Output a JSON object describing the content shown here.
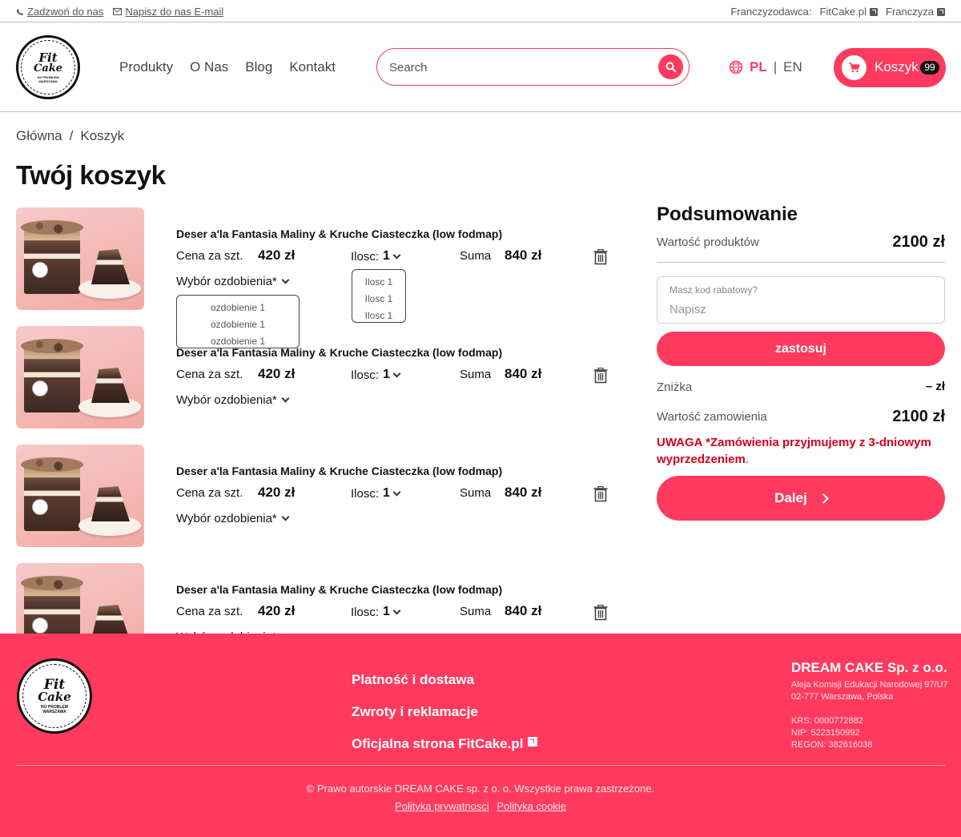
{
  "topbar": {
    "call": "Zadzwoń do nas",
    "email": "Napisz do nas E-mail",
    "franchisor_label": "Franczyzodawca:",
    "fitcake_link": "FitCake.pl",
    "franchise_link": "Franczyza"
  },
  "logo": {
    "line1": "Fit",
    "line2": "Cake",
    "line3": "NO PROBLEM",
    "line4": "WARSZAWA"
  },
  "nav": [
    "Produkty",
    "O Nas",
    "Blog",
    "Kontakt"
  ],
  "search": {
    "placeholder": "Search"
  },
  "lang": {
    "active": "PL",
    "separator": "|",
    "other": "EN"
  },
  "cart": {
    "label": "Koszyk",
    "count": "99"
  },
  "breadcrumb": {
    "home": "Główna",
    "separator": "/",
    "current": "Koszyk"
  },
  "page_title": "Twój koszyk",
  "items_labels": {
    "unit_price": "Cena za szt.",
    "qty": "Ilosc:",
    "sum": "Suma",
    "decoration": "Wybór ozdobienia*"
  },
  "items": [
    {
      "title": "Deser a'la Fantasia Maliny & Kruche Ciasteczka (low fodmap)",
      "price": "420 zł",
      "qty": "1",
      "sum": "840 zł"
    },
    {
      "title": "Deser a'la Fantasia Maliny & Kruche Ciasteczka (low fodmap)",
      "price": "420 zł",
      "qty": "1",
      "sum": "840 zł"
    },
    {
      "title": "Deser a'la Fantasia Maliny & Kruche Ciasteczka (low fodmap)",
      "price": "420 zł",
      "qty": "1",
      "sum": "840 zł"
    },
    {
      "title": "Deser a'la Fantasia Maliny & Kruche Ciasteczka (low fodmap)",
      "price": "420 zł",
      "qty": "1",
      "sum": "840 zł"
    }
  ],
  "decoration_dropdown": [
    "ozdobienie 1",
    "ozdobienie 1",
    "ozdobienie 1"
  ],
  "qty_dropdown": [
    "Ilosc 1",
    "Ilosc 1",
    "Ilosc 1"
  ],
  "summary": {
    "title": "Podsumowanie",
    "products_value_label": "Wartość produktów",
    "products_value": "2100 zł",
    "coupon_label": "Masz kod rabatowy?",
    "coupon_placeholder": "Napisz",
    "apply": "zastosuj",
    "discount_label": "Zniżka",
    "discount_value": "– zł",
    "order_value_label": "Wartość zamowienia",
    "order_value": "2100 zł",
    "warning_prefix": "UWAGA",
    "warning_text": "*Zamówienia przyjmujemy z 3-dniowym wyprzedzeniem",
    "warning_dot": ".",
    "next": "Dalej"
  },
  "footer": {
    "links": [
      "Platność i dostawa",
      "Zwroty i reklamacje",
      "Oficjalna strona FitCake.pl"
    ],
    "company_name": "DREAM CAKE Sp. z o.o.",
    "address1": "Aleja Komisji Edukacji Narodowej 97/U7",
    "address2": "02-777 Warszawa, Polska",
    "krs": "KRS: 0000772882",
    "nip": "NIP: 5223150992",
    "regon": "REGON: 382616038",
    "copyright": "© Prawo autorskie DREAM CAKE sp. z o. o. Wszystkie prawa zastrzeżone.",
    "privacy": "Polityka prywatnosci",
    "cookie": "Polityka cookie"
  },
  "colors": {
    "accent": "#ff3a5e",
    "warning": "#d8001b"
  }
}
